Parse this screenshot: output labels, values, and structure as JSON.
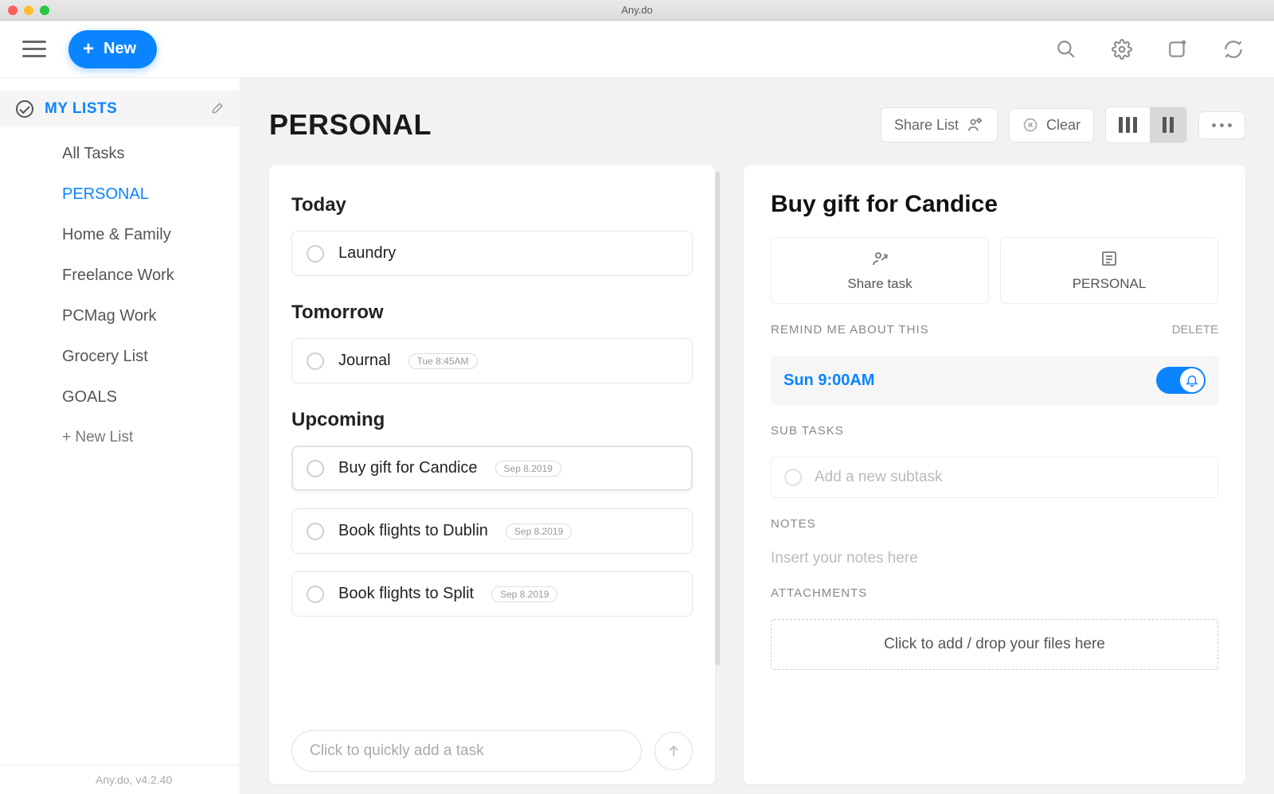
{
  "window": {
    "title": "Any.do"
  },
  "topbar": {
    "new_label": "New"
  },
  "sidebar": {
    "header": "MY LISTS",
    "items": [
      {
        "label": "All Tasks",
        "active": false
      },
      {
        "label": "PERSONAL",
        "active": true
      },
      {
        "label": "Home & Family",
        "active": false
      },
      {
        "label": "Freelance Work",
        "active": false
      },
      {
        "label": "PCMag Work",
        "active": false
      },
      {
        "label": "Grocery List",
        "active": false
      },
      {
        "label": "GOALS",
        "active": false
      }
    ],
    "new_list": "+ New List",
    "footer": "Any.do, v4.2.40"
  },
  "main": {
    "title": "PERSONAL",
    "share_label": "Share List",
    "clear_label": "Clear",
    "sections": {
      "today": {
        "title": "Today",
        "tasks": [
          {
            "label": "Laundry"
          }
        ]
      },
      "tomorrow": {
        "title": "Tomorrow",
        "tasks": [
          {
            "label": "Journal",
            "chip": "Tue 8:45AM"
          }
        ]
      },
      "upcoming": {
        "title": "Upcoming",
        "tasks": [
          {
            "label": "Buy gift for Candice",
            "chip": "Sep 8.2019",
            "highlight": true
          },
          {
            "label": "Book flights to Dublin",
            "chip": "Sep 8.2019"
          },
          {
            "label": "Book flights to Split",
            "chip": "Sep 8.2019"
          }
        ]
      }
    },
    "quick_add_placeholder": "Click to quickly add a task"
  },
  "detail": {
    "title": "Buy gift for Candice",
    "share_tile": "Share task",
    "list_tile": "PERSONAL",
    "remind_label": "REMIND ME ABOUT THIS",
    "delete_label": "DELETE",
    "reminder_time": "Sun 9:00AM",
    "subtasks_label": "SUB TASKS",
    "subtask_placeholder": "Add a new subtask",
    "notes_label": "NOTES",
    "notes_placeholder": "Insert your notes here",
    "attachments_label": "ATTACHMENTS",
    "attach_drop": "Click to add / drop your files here"
  }
}
